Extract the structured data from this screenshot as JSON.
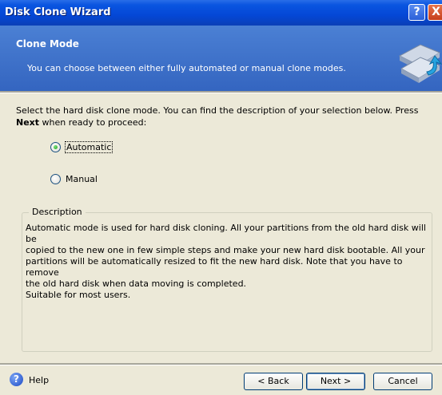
{
  "window": {
    "title": "Disk Clone Wizard",
    "help_glyph": "?",
    "close_glyph": "X"
  },
  "header": {
    "title": "Clone Mode",
    "subtitle": "You can choose between either fully automated or manual clone modes.",
    "icon": "disk-clone-icon"
  },
  "instructions": {
    "line1": "Select the hard disk clone mode. You can find the description of your selection below. Press",
    "bold": "Next",
    "line2": " when ready to proceed:"
  },
  "options": [
    {
      "label": "Automatic",
      "selected": true
    },
    {
      "label": "Manual",
      "selected": false
    }
  ],
  "description": {
    "legend": "Description",
    "lines": [
      "Automatic mode is used for hard disk cloning. All your partitions from the old hard disk will be",
      "copied to the new one in few simple steps and make your new hard disk bootable. All your",
      "partitions will be automatically resized to fit the new hard disk. Note that you have to remove",
      "the old hard disk when data moving is completed.",
      "Suitable for most users."
    ]
  },
  "footer": {
    "help_glyph": "?",
    "help_label": "Help",
    "back_label": "< Back",
    "next_label": "Next >",
    "cancel_label": "Cancel"
  }
}
